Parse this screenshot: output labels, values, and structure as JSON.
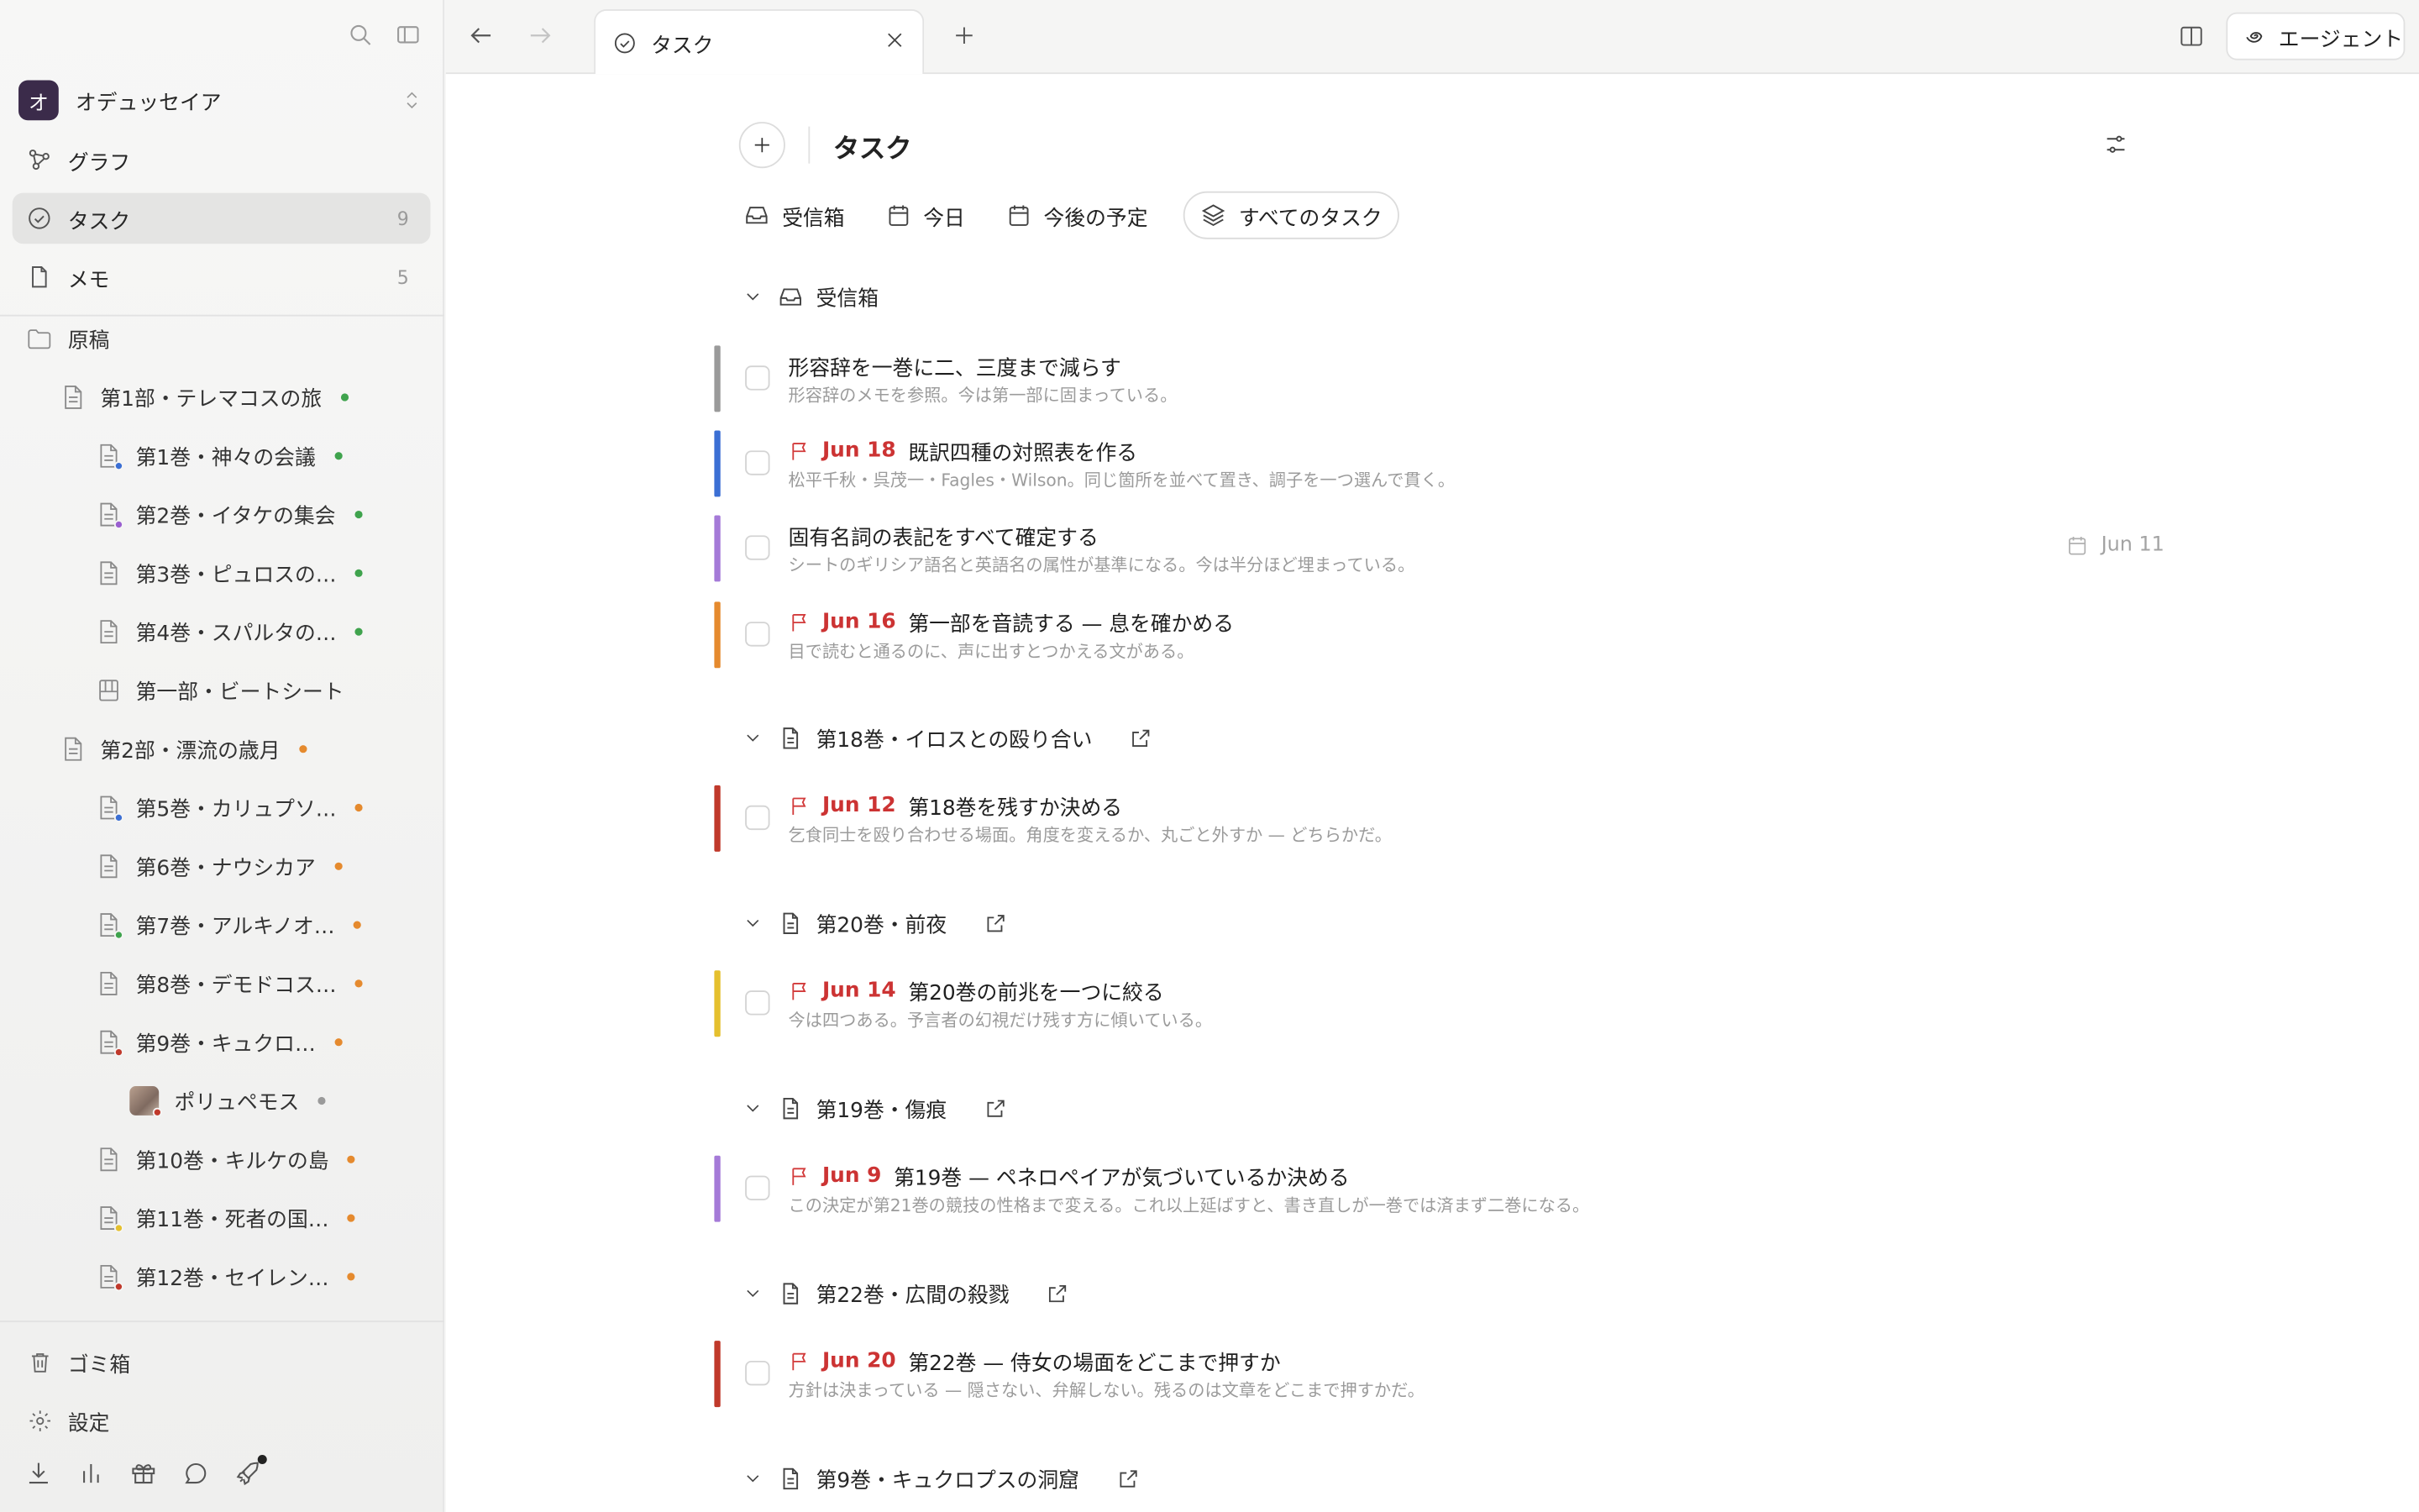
{
  "workspace": {
    "initial": "オ",
    "name": "オデュッセイア"
  },
  "nav": [
    {
      "label": "グラフ",
      "count": ""
    },
    {
      "label": "タスク",
      "count": "9"
    },
    {
      "label": "メモ",
      "count": "5"
    }
  ],
  "tree": {
    "root": "原稿",
    "items": [
      {
        "label": "第1部・テレマコスの旅",
        "dot": "#3fa34d"
      },
      {
        "label": "第1巻・神々の会議",
        "dot": "#3fa34d",
        "sub": "#3b6fd4"
      },
      {
        "label": "第2巻・イタケの集会",
        "dot": "#3fa34d",
        "sub": "#9a5fd0"
      },
      {
        "label": "第3巻・ピュロスの…",
        "dot": "#3fa34d"
      },
      {
        "label": "第4巻・スパルタの…",
        "dot": "#3fa34d"
      },
      {
        "label": "第一部・ビートシート",
        "dot": ""
      },
      {
        "label": "第2部・漂流の歳月",
        "dot": "#e58a2e"
      },
      {
        "label": "第5巻・カリュプソ…",
        "dot": "#e58a2e",
        "sub": "#3b6fd4"
      },
      {
        "label": "第6巻・ナウシカア",
        "dot": "#e58a2e"
      },
      {
        "label": "第7巻・アルキノオ…",
        "dot": "#e58a2e",
        "sub": "#3fa34d"
      },
      {
        "label": "第8巻・デモドコス…",
        "dot": "#e58a2e"
      },
      {
        "label": "第9巻・キュクロ…",
        "dot": "#e58a2e",
        "sub": "#c0392b"
      },
      {
        "label": "ポリュペモス",
        "dot": "#9a9a9a"
      },
      {
        "label": "第10巻・キルケの島",
        "dot": "#e58a2e"
      },
      {
        "label": "第11巻・死者の国…",
        "dot": "#e58a2e",
        "sub": "#e5c02e"
      },
      {
        "label": "第12巻・セイレン…",
        "dot": "#e58a2e",
        "sub": "#c0392b"
      }
    ]
  },
  "bottom": {
    "trash": "ゴミ箱",
    "settings": "設定"
  },
  "tab": {
    "label": "タスク"
  },
  "agent": {
    "label": "エージェント"
  },
  "page": {
    "title": "タスク"
  },
  "views": [
    "受信箱",
    "今日",
    "今後の予定",
    "すべてのタスク"
  ],
  "sections": [
    {
      "title": "受信箱",
      "tasks": [
        {
          "bar": "#9a9a9a",
          "due": "",
          "title": "形容辞を一巻に二、三度まで減らす",
          "note": "形容辞のメモを参照。今は第一部に固まっている。",
          "rdate": ""
        },
        {
          "bar": "#3b6fd4",
          "due": "Jun 18",
          "title": "既訳四種の対照表を作る",
          "note": "松平千秋・呉茂一・Fagles・Wilson。同じ箇所を並べて置き、調子を一つ選んで貫く。",
          "rdate": ""
        },
        {
          "bar": "#a57ad8",
          "due": "",
          "title": "固有名詞の表記をすべて確定する",
          "note": "シートのギリシア語名と英語名の属性が基準になる。今は半分ほど埋まっている。",
          "rdate": "Jun 11"
        },
        {
          "bar": "#e58a2e",
          "due": "Jun 16",
          "title": "第一部を音読する — 息を確かめる",
          "note": "目で読むと通るのに、声に出すとつかえる文がある。",
          "rdate": ""
        }
      ]
    },
    {
      "title": "第18巻・イロスとの殴り合い",
      "tasks": [
        {
          "bar": "#c0392b",
          "due": "Jun 12",
          "title": "第18巻を残すか決める",
          "note": "乞食同士を殴り合わせる場面。角度を変えるか、丸ごと外すか — どちらかだ。",
          "rdate": ""
        }
      ]
    },
    {
      "title": "第20巻・前夜",
      "tasks": [
        {
          "bar": "#e5c02e",
          "due": "Jun 14",
          "title": "第20巻の前兆を一つに絞る",
          "note": "今は四つある。予言者の幻視だけ残す方に傾いている。",
          "rdate": ""
        }
      ]
    },
    {
      "title": "第19巻・傷痕",
      "tasks": [
        {
          "bar": "#a57ad8",
          "due": "Jun 9",
          "title": "第19巻 — ペネロペイアが気づいているか決める",
          "note": "この決定が第21巻の競技の性格まで変える。これ以上延ばすと、書き直しが一巻では済まず二巻になる。",
          "rdate": ""
        }
      ]
    },
    {
      "title": "第22巻・広間の殺戮",
      "tasks": [
        {
          "bar": "#c0392b",
          "due": "Jun 20",
          "title": "第22巻 — 侍女の場面をどこまで押すか",
          "note": "方針は決まっている — 隠さない、弁解しない。残るのは文章をどこまで押すかだ。",
          "rdate": ""
        }
      ]
    },
    {
      "title": "第9巻・キュクロプスの洞窟",
      "tasks": []
    }
  ]
}
